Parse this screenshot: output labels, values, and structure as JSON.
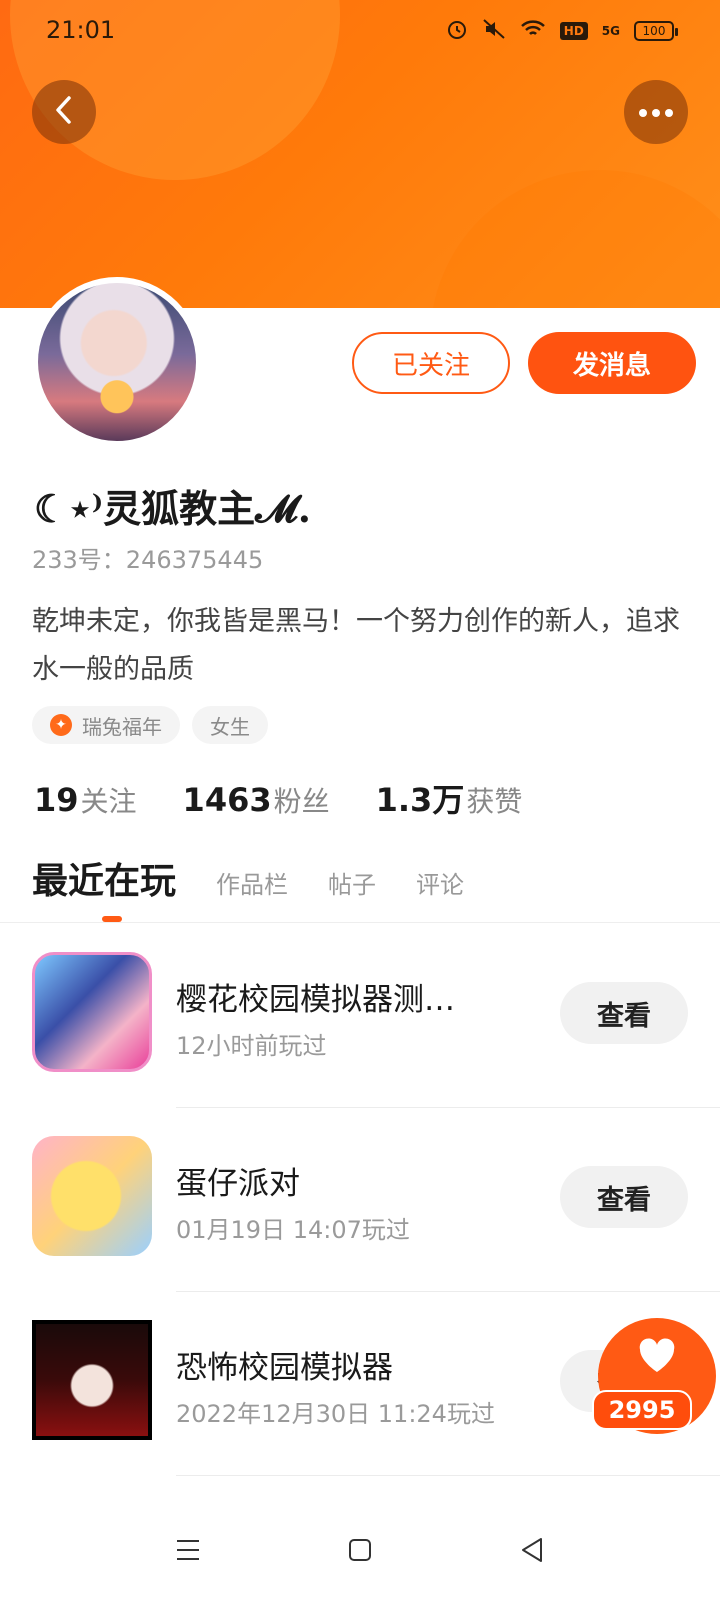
{
  "status_bar": {
    "time": "21:01",
    "hd": "HD",
    "signal": "5G",
    "battery": "100"
  },
  "header": {
    "back_icon": "chevron-left-icon",
    "more_icon": "more-dots-icon"
  },
  "profile": {
    "follow_button": "已关注",
    "message_button": "发消息",
    "username": "☾⋆⁾灵狐教主𝓜.",
    "uid": "233号：246375445",
    "bio": "乾坤未定，你我皆是黑马！一个努力创作的新人，追求水一般的品质",
    "tags": [
      "瑞兔福年",
      "女生"
    ],
    "stats": [
      {
        "num": "19",
        "label": "关注"
      },
      {
        "num": "1463",
        "label": "粉丝"
      },
      {
        "num": "1.3万",
        "label": "获赞"
      }
    ]
  },
  "tabs": [
    "最近在玩",
    "作品栏",
    "帖子",
    "评论"
  ],
  "games": [
    {
      "title": "樱花校园模拟器测…",
      "time": "12小时前玩过",
      "button": "查看"
    },
    {
      "title": "蛋仔派对",
      "time": "01月19日 14:07玩过",
      "button": "查看"
    },
    {
      "title": "恐怖校园模拟器",
      "time": "2022年12月30日 11:24玩过",
      "button": "查看"
    }
  ],
  "fab": {
    "icon": "heart-icon",
    "count": "2995"
  },
  "colors": {
    "accent": "#ff5310",
    "header": "#ff7a0a"
  }
}
